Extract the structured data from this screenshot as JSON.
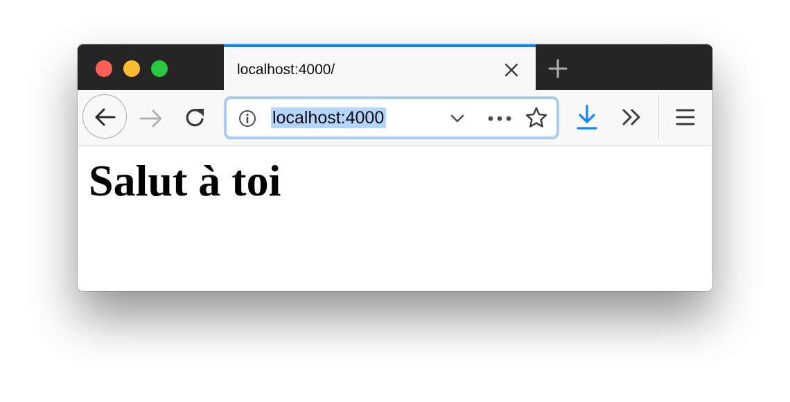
{
  "tab": {
    "title": "localhost:4000/"
  },
  "urlbar": {
    "url": "localhost:4000"
  },
  "page": {
    "heading": "Salut à toi"
  },
  "icons": {
    "window_close": "traffic-light-close",
    "window_minimize": "traffic-light-minimize",
    "window_maximize": "traffic-light-maximize",
    "tab_close": "close-icon",
    "new_tab": "plus-icon",
    "back": "arrow-left-icon",
    "forward": "arrow-right-icon",
    "reload": "reload-icon",
    "site_info": "info-icon",
    "url_dropdown": "chevron-down-icon",
    "page_actions": "ellipsis-icon",
    "bookmark": "star-icon",
    "downloads": "download-icon",
    "overflow": "double-chevron-icon",
    "menu": "hamburger-icon"
  },
  "colors": {
    "titlebar": "#252525",
    "tab_accent": "#0a84ff",
    "toolbar": "#f9f9fa",
    "urlbar_focus_ring": "#a6ccf6",
    "url_selection": "#b4d5fe",
    "download_icon": "#0a84ff",
    "close_button": "#fd5f57",
    "minimize_button": "#febc2e",
    "maximize_button": "#28c840"
  }
}
